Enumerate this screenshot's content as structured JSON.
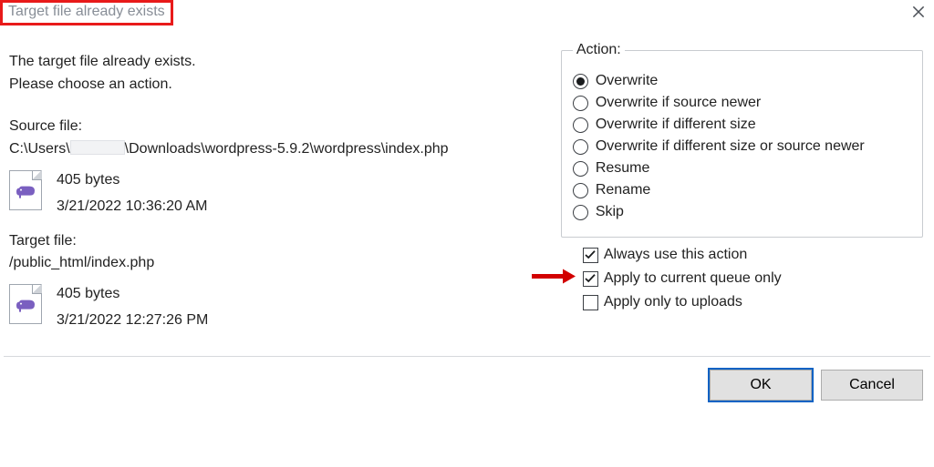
{
  "window": {
    "title": "Target file already exists"
  },
  "message": {
    "line1": "The target file already exists.",
    "line2": "Please choose an action."
  },
  "source": {
    "label": "Source file:",
    "path_prefix": "C:\\Users\\",
    "path_suffix": "\\Downloads\\wordpress-5.9.2\\wordpress\\index.php",
    "size": "405 bytes",
    "mtime": "3/21/2022 10:36:20 AM"
  },
  "target": {
    "label": "Target file:",
    "path": "/public_html/index.php",
    "size": "405 bytes",
    "mtime": "3/21/2022 12:27:26 PM"
  },
  "actions": {
    "legend": "Action:",
    "options": {
      "overwrite": "Overwrite",
      "overwrite_newer": "Overwrite if source newer",
      "overwrite_size": "Overwrite if different size",
      "overwrite_size_newer": "Overwrite if different size or source newer",
      "resume": "Resume",
      "rename": "Rename",
      "skip": "Skip"
    },
    "selected": "overwrite"
  },
  "checks": {
    "always": {
      "label": "Always use this action",
      "checked": true
    },
    "queue_only": {
      "label": "Apply to current queue only",
      "checked": true,
      "arrow": true
    },
    "uploads_only": {
      "label": "Apply only to uploads",
      "checked": false
    }
  },
  "buttons": {
    "ok": "OK",
    "cancel": "Cancel"
  }
}
